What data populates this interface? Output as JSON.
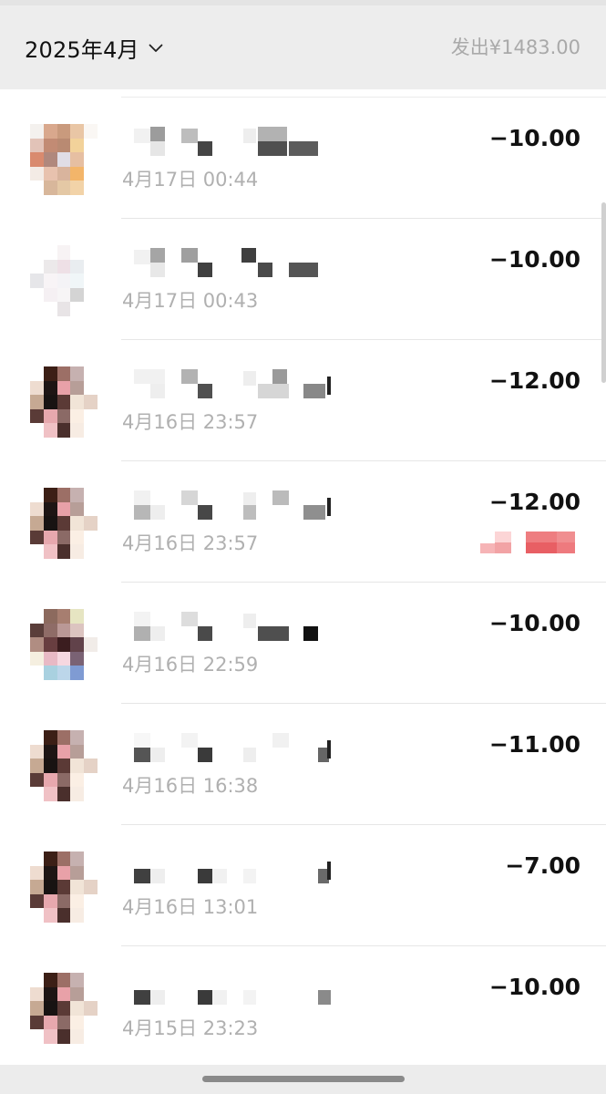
{
  "header": {
    "month_label": "2025年4月",
    "summary": "发出¥1483.00"
  },
  "transactions": [
    {
      "amount": "−10.00",
      "time": "4月17日 00:44",
      "avatar": "blurred",
      "name": "blurred",
      "has_tag": false
    },
    {
      "amount": "−10.00",
      "time": "4月17日 00:43",
      "avatar": "blurred",
      "name": "blurred",
      "has_tag": false
    },
    {
      "amount": "−12.00",
      "time": "4月16日 23:57",
      "avatar": "blurred",
      "name": "blurred",
      "has_tag": false
    },
    {
      "amount": "−12.00",
      "time": "4月16日 23:57",
      "avatar": "blurred",
      "name": "blurred",
      "has_tag": true
    },
    {
      "amount": "−10.00",
      "time": "4月16日 22:59",
      "avatar": "blurred",
      "name": "blurred",
      "has_tag": false
    },
    {
      "amount": "−11.00",
      "time": "4月16日 16:38",
      "avatar": "blurred",
      "name": "blurred",
      "has_tag": false
    },
    {
      "amount": "−7.00",
      "time": "4月16日 13:01",
      "avatar": "blurred",
      "name": "blurred",
      "has_tag": false
    },
    {
      "amount": "−10.00",
      "time": "4月15日 23:23",
      "avatar": "blurred",
      "name": "blurred",
      "has_tag": false
    }
  ],
  "icons": {
    "month_dropdown": "chevron-down-icon"
  },
  "colors": {
    "header_bg": "#ededed",
    "amount_text": "#111111",
    "secondary_text": "#b0b0b0",
    "tag_accent": "#e8787c"
  }
}
